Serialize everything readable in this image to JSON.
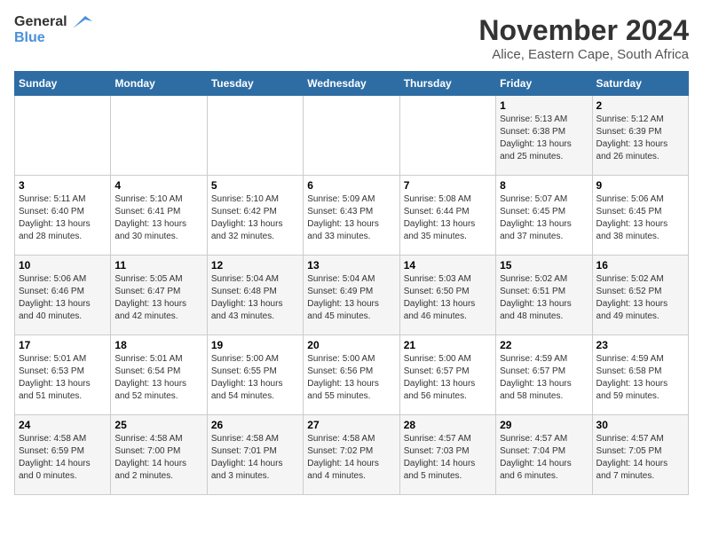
{
  "logo": {
    "line1": "General",
    "line2": "Blue"
  },
  "title": "November 2024",
  "subtitle": "Alice, Eastern Cape, South Africa",
  "days_header": [
    "Sunday",
    "Monday",
    "Tuesday",
    "Wednesday",
    "Thursday",
    "Friday",
    "Saturday"
  ],
  "weeks": [
    [
      {
        "day": "",
        "info": ""
      },
      {
        "day": "",
        "info": ""
      },
      {
        "day": "",
        "info": ""
      },
      {
        "day": "",
        "info": ""
      },
      {
        "day": "",
        "info": ""
      },
      {
        "day": "1",
        "info": "Sunrise: 5:13 AM\nSunset: 6:38 PM\nDaylight: 13 hours\nand 25 minutes."
      },
      {
        "day": "2",
        "info": "Sunrise: 5:12 AM\nSunset: 6:39 PM\nDaylight: 13 hours\nand 26 minutes."
      }
    ],
    [
      {
        "day": "3",
        "info": "Sunrise: 5:11 AM\nSunset: 6:40 PM\nDaylight: 13 hours\nand 28 minutes."
      },
      {
        "day": "4",
        "info": "Sunrise: 5:10 AM\nSunset: 6:41 PM\nDaylight: 13 hours\nand 30 minutes."
      },
      {
        "day": "5",
        "info": "Sunrise: 5:10 AM\nSunset: 6:42 PM\nDaylight: 13 hours\nand 32 minutes."
      },
      {
        "day": "6",
        "info": "Sunrise: 5:09 AM\nSunset: 6:43 PM\nDaylight: 13 hours\nand 33 minutes."
      },
      {
        "day": "7",
        "info": "Sunrise: 5:08 AM\nSunset: 6:44 PM\nDaylight: 13 hours\nand 35 minutes."
      },
      {
        "day": "8",
        "info": "Sunrise: 5:07 AM\nSunset: 6:45 PM\nDaylight: 13 hours\nand 37 minutes."
      },
      {
        "day": "9",
        "info": "Sunrise: 5:06 AM\nSunset: 6:45 PM\nDaylight: 13 hours\nand 38 minutes."
      }
    ],
    [
      {
        "day": "10",
        "info": "Sunrise: 5:06 AM\nSunset: 6:46 PM\nDaylight: 13 hours\nand 40 minutes."
      },
      {
        "day": "11",
        "info": "Sunrise: 5:05 AM\nSunset: 6:47 PM\nDaylight: 13 hours\nand 42 minutes."
      },
      {
        "day": "12",
        "info": "Sunrise: 5:04 AM\nSunset: 6:48 PM\nDaylight: 13 hours\nand 43 minutes."
      },
      {
        "day": "13",
        "info": "Sunrise: 5:04 AM\nSunset: 6:49 PM\nDaylight: 13 hours\nand 45 minutes."
      },
      {
        "day": "14",
        "info": "Sunrise: 5:03 AM\nSunset: 6:50 PM\nDaylight: 13 hours\nand 46 minutes."
      },
      {
        "day": "15",
        "info": "Sunrise: 5:02 AM\nSunset: 6:51 PM\nDaylight: 13 hours\nand 48 minutes."
      },
      {
        "day": "16",
        "info": "Sunrise: 5:02 AM\nSunset: 6:52 PM\nDaylight: 13 hours\nand 49 minutes."
      }
    ],
    [
      {
        "day": "17",
        "info": "Sunrise: 5:01 AM\nSunset: 6:53 PM\nDaylight: 13 hours\nand 51 minutes."
      },
      {
        "day": "18",
        "info": "Sunrise: 5:01 AM\nSunset: 6:54 PM\nDaylight: 13 hours\nand 52 minutes."
      },
      {
        "day": "19",
        "info": "Sunrise: 5:00 AM\nSunset: 6:55 PM\nDaylight: 13 hours\nand 54 minutes."
      },
      {
        "day": "20",
        "info": "Sunrise: 5:00 AM\nSunset: 6:56 PM\nDaylight: 13 hours\nand 55 minutes."
      },
      {
        "day": "21",
        "info": "Sunrise: 5:00 AM\nSunset: 6:57 PM\nDaylight: 13 hours\nand 56 minutes."
      },
      {
        "day": "22",
        "info": "Sunrise: 4:59 AM\nSunset: 6:57 PM\nDaylight: 13 hours\nand 58 minutes."
      },
      {
        "day": "23",
        "info": "Sunrise: 4:59 AM\nSunset: 6:58 PM\nDaylight: 13 hours\nand 59 minutes."
      }
    ],
    [
      {
        "day": "24",
        "info": "Sunrise: 4:58 AM\nSunset: 6:59 PM\nDaylight: 14 hours\nand 0 minutes."
      },
      {
        "day": "25",
        "info": "Sunrise: 4:58 AM\nSunset: 7:00 PM\nDaylight: 14 hours\nand 2 minutes."
      },
      {
        "day": "26",
        "info": "Sunrise: 4:58 AM\nSunset: 7:01 PM\nDaylight: 14 hours\nand 3 minutes."
      },
      {
        "day": "27",
        "info": "Sunrise: 4:58 AM\nSunset: 7:02 PM\nDaylight: 14 hours\nand 4 minutes."
      },
      {
        "day": "28",
        "info": "Sunrise: 4:57 AM\nSunset: 7:03 PM\nDaylight: 14 hours\nand 5 minutes."
      },
      {
        "day": "29",
        "info": "Sunrise: 4:57 AM\nSunset: 7:04 PM\nDaylight: 14 hours\nand 6 minutes."
      },
      {
        "day": "30",
        "info": "Sunrise: 4:57 AM\nSunset: 7:05 PM\nDaylight: 14 hours\nand 7 minutes."
      }
    ]
  ]
}
